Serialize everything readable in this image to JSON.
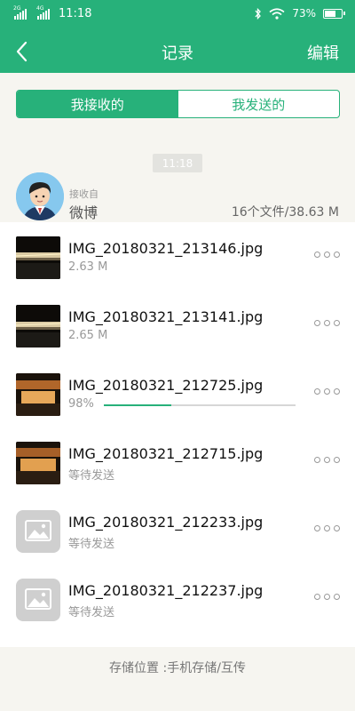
{
  "status_bar": {
    "sim1_tag": "2G",
    "sim2_tag": "4G",
    "time": "11:18",
    "battery": "73%",
    "battery_level": 0.73,
    "icons": [
      "bluetooth-icon",
      "wifi-icon",
      "battery-icon"
    ]
  },
  "nav": {
    "back_icon": "back-arrow-icon",
    "title": "记录",
    "edit_label": "编辑"
  },
  "tabs": [
    {
      "label": "我接收的",
      "active": true
    },
    {
      "label": "我发送的",
      "active": false
    }
  ],
  "time_chip": "11:18",
  "sender": {
    "from_label": "接收自",
    "name": "微博",
    "summary": "16个文件/38.63 M"
  },
  "files": [
    {
      "name": "IMG_20180321_213146.jpg",
      "sub": "2.63 M",
      "thumb": "photo-bridge"
    },
    {
      "name": "IMG_20180321_213141.jpg",
      "sub": "2.65 M",
      "thumb": "photo-bridge"
    },
    {
      "name": "IMG_20180321_212725.jpg",
      "sub": "98%",
      "thumb": "photo-street",
      "progress": 0.35
    },
    {
      "name": "IMG_20180321_212715.jpg",
      "sub": "等待发送",
      "thumb": "photo-street"
    },
    {
      "name": "IMG_20180321_212233.jpg",
      "sub": "等待发送",
      "thumb": "image-placeholder-icon"
    },
    {
      "name": "IMG_20180321_212237.jpg",
      "sub": "等待发送",
      "thumb": "image-placeholder-icon"
    }
  ],
  "storage_label": "存储位置 :手机存储/互传",
  "colors": {
    "accent": "#27b17a",
    "background": "#f6f5f0"
  }
}
